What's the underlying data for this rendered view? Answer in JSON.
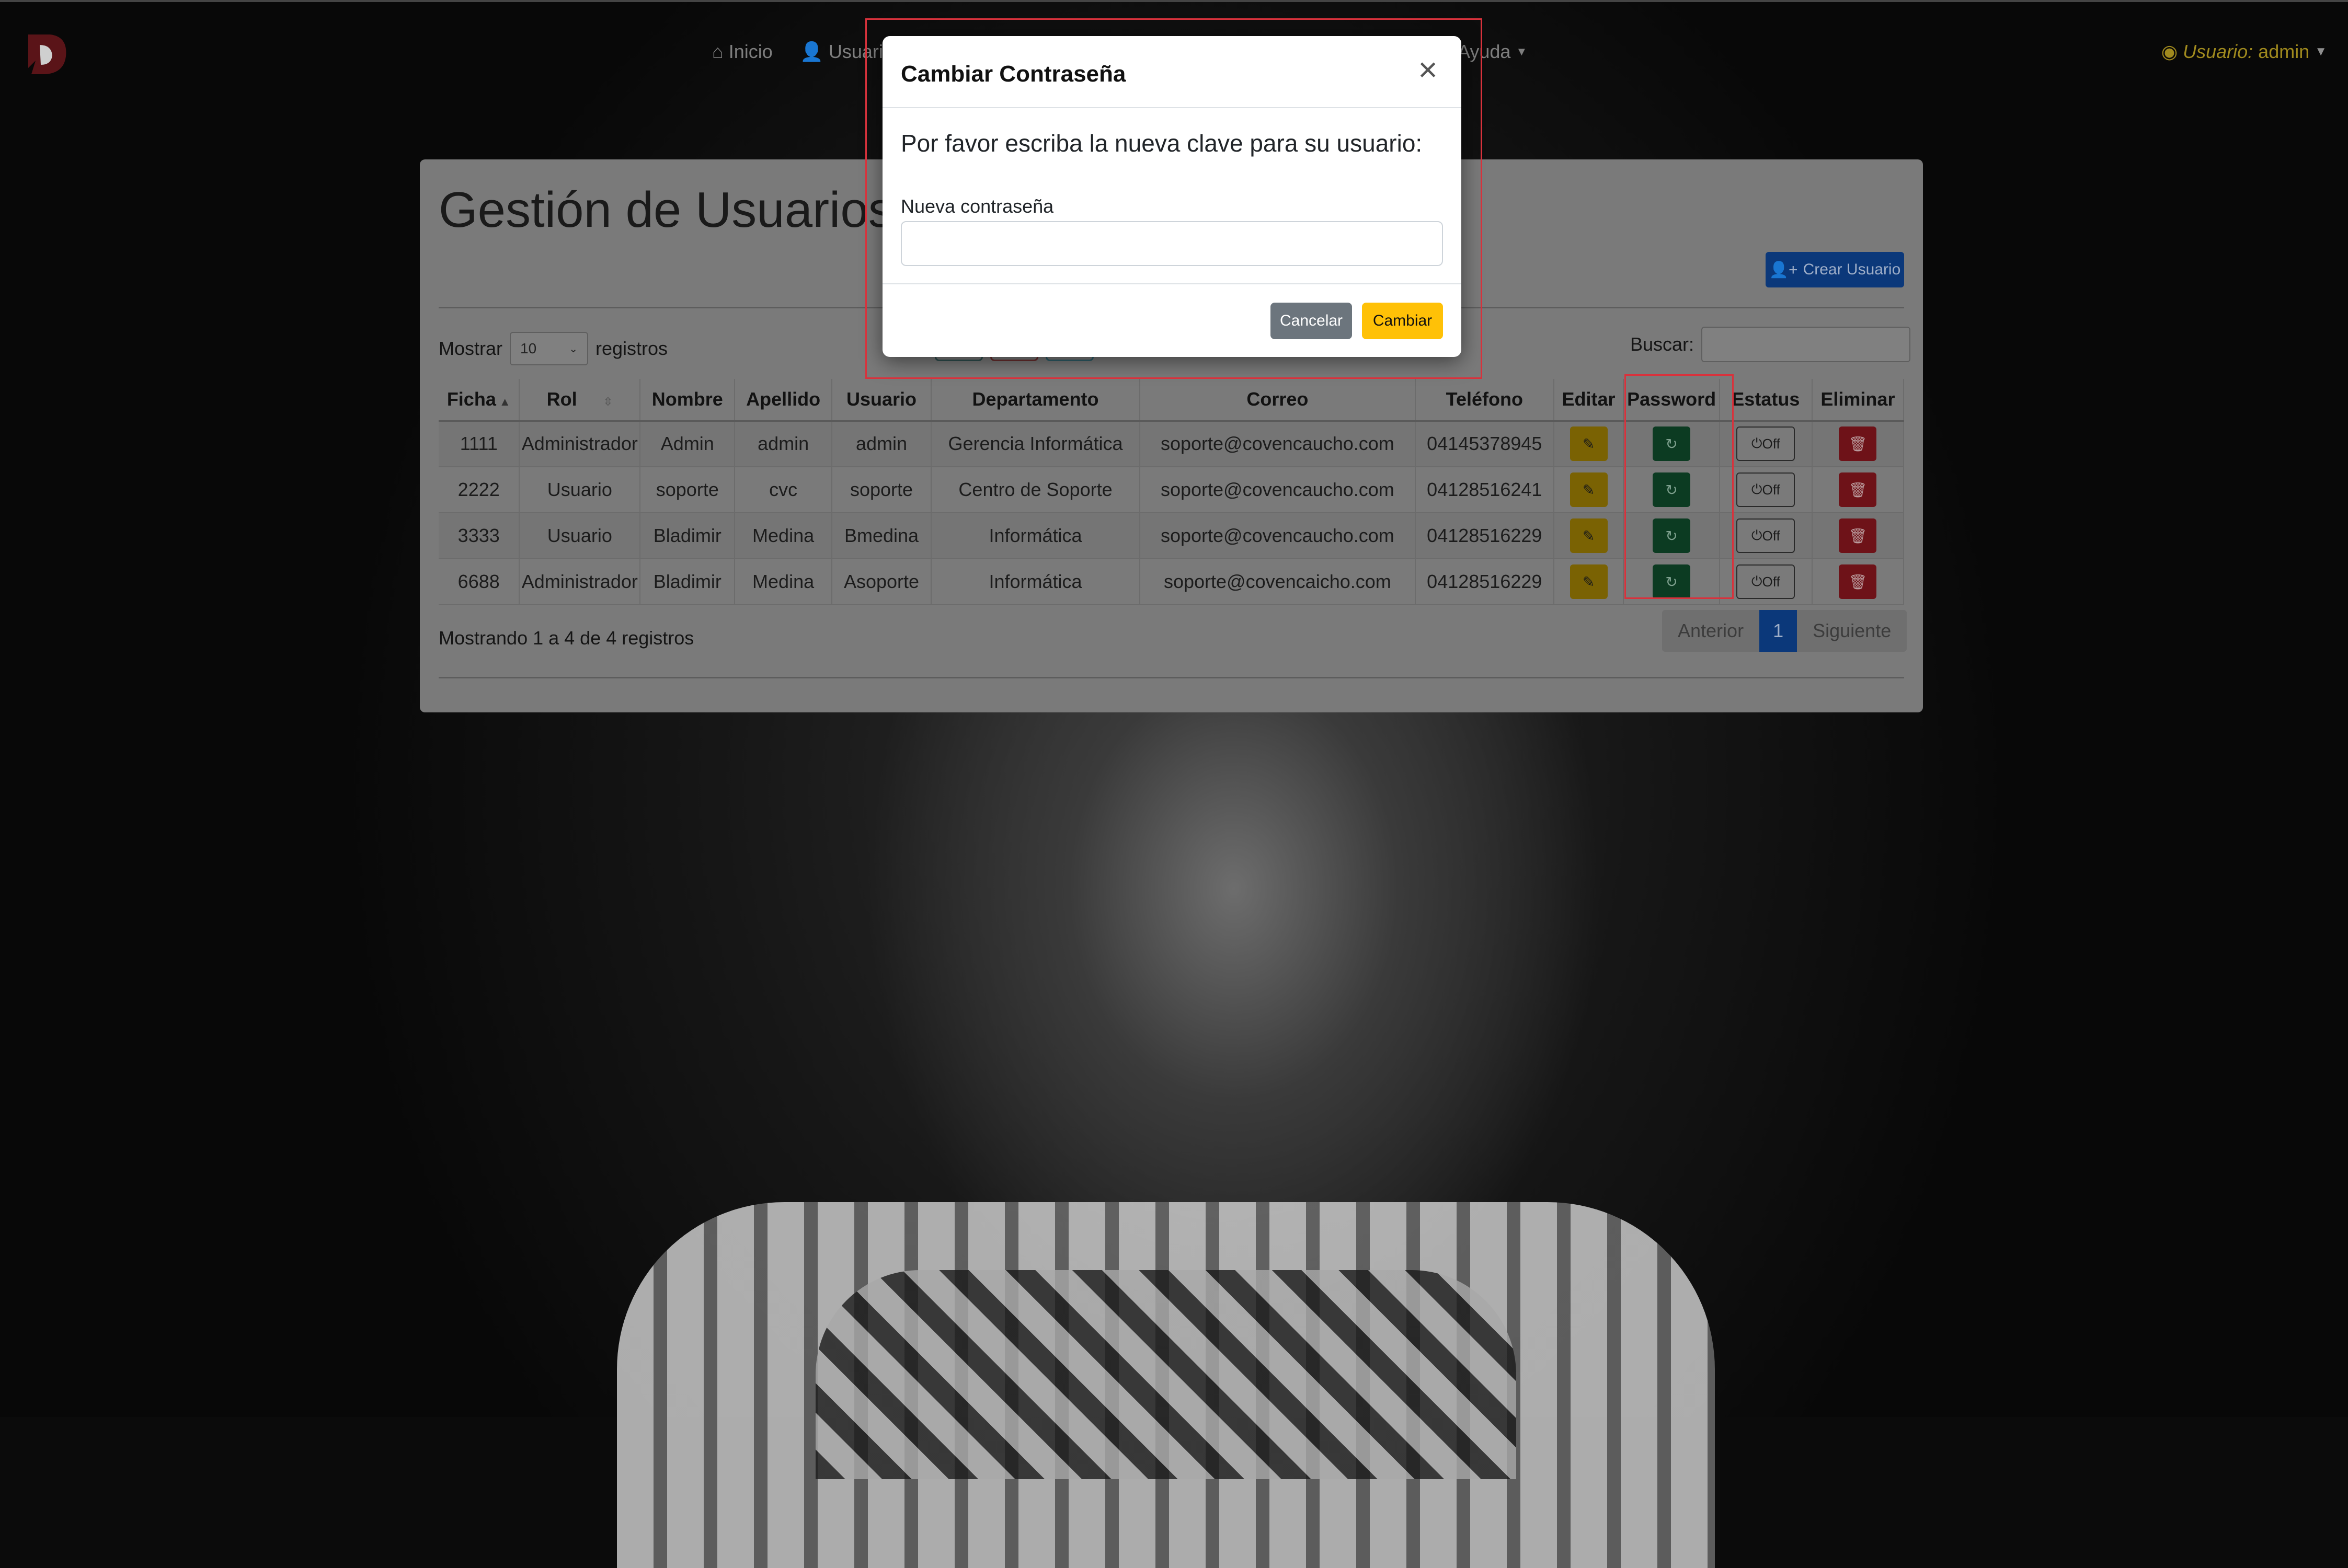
{
  "nav": {
    "items": [
      {
        "label": "Inicio",
        "icon": "home-icon"
      },
      {
        "label": "Usuario",
        "icon": "person-icon"
      },
      {
        "label": "Ayuda",
        "icon": "chevron-down-icon"
      }
    ],
    "user_prefix": "Usuario:",
    "user_name": "admin"
  },
  "page": {
    "title": "Gestión de Usuarios",
    "create_button": "Crear Usuario",
    "show_prefix": "Mostrar",
    "show_value": "10",
    "show_suffix": "registros",
    "search_label": "Buscar:",
    "search_value": ""
  },
  "table": {
    "headers": [
      "Ficha",
      "Rol",
      "Nombre",
      "Apellido",
      "Usuario",
      "Departamento",
      "Correo",
      "Teléfono",
      "Editar",
      "Password",
      "Estatus",
      "Eliminar"
    ],
    "rows": [
      {
        "ficha": "1111",
        "rol": "Administrador",
        "nombre": "Admin",
        "apellido": "admin",
        "usuario": "admin",
        "departamento": "Gerencia Informática",
        "correo": "soporte@covencaucho.com",
        "telefono": "04145378945",
        "estatus": "Off"
      },
      {
        "ficha": "2222",
        "rol": "Usuario",
        "nombre": "soporte",
        "apellido": "cvc",
        "usuario": "soporte",
        "departamento": "Centro de Soporte",
        "correo": "soporte@covencaucho.com",
        "telefono": "04128516241",
        "estatus": "Off"
      },
      {
        "ficha": "3333",
        "rol": "Usuario",
        "nombre": "Bladimir",
        "apellido": "Medina",
        "usuario": "Bmedina",
        "departamento": "Informática",
        "correo": "soporte@covencaucho.com",
        "telefono": "04128516229",
        "estatus": "Off"
      },
      {
        "ficha": "6688",
        "rol": "Administrador",
        "nombre": "Bladimir",
        "apellido": "Medina",
        "usuario": "Asoporte",
        "departamento": "Informática",
        "correo": "soporte@covencaicho.com",
        "telefono": "04128516229",
        "estatus": "Off"
      }
    ]
  },
  "footer": {
    "info": "Mostrando 1 a 4 de 4 registros",
    "prev": "Anterior",
    "current_page": "1",
    "next": "Siguiente"
  },
  "modal": {
    "title": "Cambiar Contraseña",
    "message": "Por favor escriba la nueva clave para su usuario:",
    "field_label": "Nueva contraseña",
    "field_value": "",
    "cancel": "Cancelar",
    "confirm": "Cambiar"
  },
  "colors": {
    "highlight": "#d8323c",
    "primary": "#0d6efd",
    "warning": "#ffc107",
    "success": "#198754",
    "danger": "#dc3545",
    "secondary": "#6c757d"
  }
}
